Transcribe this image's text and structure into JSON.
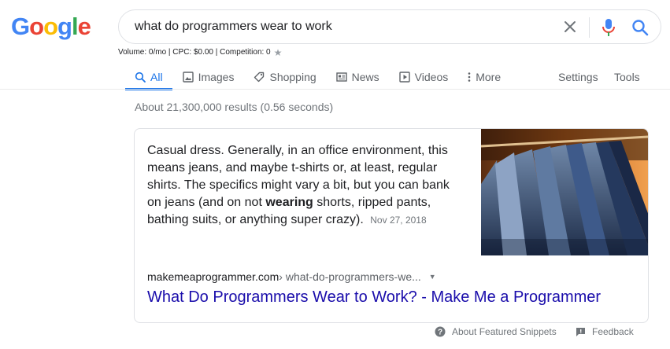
{
  "logo": {
    "letters": [
      "G",
      "o",
      "o",
      "g",
      "l",
      "e"
    ],
    "colors": [
      "#4285F4",
      "#EA4335",
      "#FBBC05",
      "#4285F4",
      "#34A853",
      "#EA4335"
    ]
  },
  "search": {
    "query": "what do programmers wear to work",
    "clear_icon": "close-icon",
    "mic_icon": "microphone-icon",
    "search_icon": "magnifier-icon"
  },
  "seo_bar": {
    "text": "Volume: 0/mo | CPC: $0.00 | Competition: 0",
    "star": "★"
  },
  "tabs": [
    {
      "label": "All",
      "icon": "search-icon",
      "active": true
    },
    {
      "label": "Images",
      "icon": "image-icon",
      "active": false
    },
    {
      "label": "Shopping",
      "icon": "tag-icon",
      "active": false
    },
    {
      "label": "News",
      "icon": "newspaper-icon",
      "active": false
    },
    {
      "label": "Videos",
      "icon": "play-icon",
      "active": false
    },
    {
      "label": "More",
      "icon": "more-vertical-icon",
      "active": false
    }
  ],
  "tools": {
    "settings": "Settings",
    "tools": "Tools"
  },
  "result_stats": "About 21,300,000 results (0.56 seconds)",
  "snippet": {
    "text_before": "Casual dress. Generally, in an office environment, this means jeans, and maybe t-shirts or, at least, regular shirts. The specifics might vary a bit, but you can bank on jeans (and on not ",
    "bold": "wearing",
    "text_after": " shorts, ripped pants, bathing suits, or anything super crazy).",
    "date": "Nov 27, 2018",
    "image_alt": "clothing rack with shirts",
    "cite_domain": "makemeaprogrammer.com",
    "cite_path": " › what-do-programmers-we...",
    "caret": "▼",
    "title": "What Do Programmers Wear to Work? - Make Me a Programmer"
  },
  "footer": {
    "about_label": "About Featured Snippets",
    "feedback_label": "Feedback"
  },
  "colors": {
    "accent": "#1a73e8",
    "link": "#1a0dab",
    "muted": "#70757a"
  }
}
